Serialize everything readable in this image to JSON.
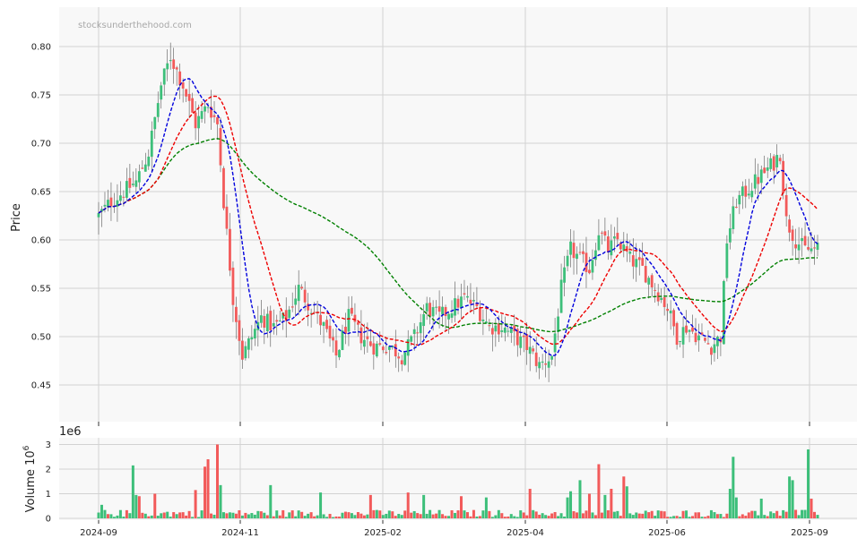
{
  "chart_data": {
    "type": "candlestick",
    "watermark": "stocksunderthehood.com",
    "ylabel": "Price",
    "volume_ylabel": "Volume  10",
    "volume_ylabel_exp": "6",
    "volume_offset_text": "1e6",
    "x_ticks": [
      "2024-09",
      "2024-11",
      "2025-02",
      "2025-04",
      "2025-06",
      "2025-09"
    ],
    "y_ticks": [
      "0.45",
      "0.50",
      "0.55",
      "0.60",
      "0.65",
      "0.70",
      "0.75",
      "0.80"
    ],
    "volume_ticks": [
      "0",
      "1",
      "2",
      "3"
    ],
    "ylim": [
      0.41,
      0.84
    ],
    "volume_ylim": [
      0,
      3.0
    ],
    "grid": true,
    "colors": {
      "up": "#3dbf7a",
      "down": "#f25a5a",
      "ma_short": "#0000dd",
      "ma_mid": "#ee0000",
      "ma_long": "#008000",
      "wick": "#555555"
    },
    "price_anchors": [
      {
        "t": 0,
        "p": 0.625
      },
      {
        "t": 4,
        "p": 0.64
      },
      {
        "t": 8,
        "p": 0.65
      },
      {
        "t": 12,
        "p": 0.66
      },
      {
        "t": 16,
        "p": 0.69
      },
      {
        "t": 20,
        "p": 0.76
      },
      {
        "t": 23,
        "p": 0.79
      },
      {
        "t": 27,
        "p": 0.76
      },
      {
        "t": 31,
        "p": 0.72
      },
      {
        "t": 35,
        "p": 0.74
      },
      {
        "t": 38,
        "p": 0.72
      },
      {
        "t": 40,
        "p": 0.64
      },
      {
        "t": 43,
        "p": 0.54
      },
      {
        "t": 46,
        "p": 0.48
      },
      {
        "t": 49,
        "p": 0.5
      },
      {
        "t": 52,
        "p": 0.52
      },
      {
        "t": 56,
        "p": 0.51
      },
      {
        "t": 60,
        "p": 0.52
      },
      {
        "t": 64,
        "p": 0.55
      },
      {
        "t": 68,
        "p": 0.53
      },
      {
        "t": 72,
        "p": 0.51
      },
      {
        "t": 76,
        "p": 0.48
      },
      {
        "t": 80,
        "p": 0.52
      },
      {
        "t": 84,
        "p": 0.5
      },
      {
        "t": 88,
        "p": 0.49
      },
      {
        "t": 93,
        "p": 0.49
      },
      {
        "t": 97,
        "p": 0.48
      },
      {
        "t": 101,
        "p": 0.5
      },
      {
        "t": 105,
        "p": 0.53
      },
      {
        "t": 109,
        "p": 0.52
      },
      {
        "t": 113,
        "p": 0.53
      },
      {
        "t": 117,
        "p": 0.54
      },
      {
        "t": 121,
        "p": 0.53
      },
      {
        "t": 125,
        "p": 0.51
      },
      {
        "t": 129,
        "p": 0.51
      },
      {
        "t": 133,
        "p": 0.5
      },
      {
        "t": 137,
        "p": 0.49
      },
      {
        "t": 141,
        "p": 0.47
      },
      {
        "t": 145,
        "p": 0.48
      },
      {
        "t": 148,
        "p": 0.55
      },
      {
        "t": 151,
        "p": 0.59
      },
      {
        "t": 154,
        "p": 0.58
      },
      {
        "t": 157,
        "p": 0.57
      },
      {
        "t": 160,
        "p": 0.61
      },
      {
        "t": 163,
        "p": 0.59
      },
      {
        "t": 166,
        "p": 0.6
      },
      {
        "t": 170,
        "p": 0.58
      },
      {
        "t": 174,
        "p": 0.57
      },
      {
        "t": 178,
        "p": 0.55
      },
      {
        "t": 182,
        "p": 0.53
      },
      {
        "t": 185,
        "p": 0.5
      },
      {
        "t": 188,
        "p": 0.51
      },
      {
        "t": 192,
        "p": 0.5
      },
      {
        "t": 196,
        "p": 0.49
      },
      {
        "t": 199,
        "p": 0.5
      },
      {
        "t": 201,
        "p": 0.6
      },
      {
        "t": 204,
        "p": 0.64
      },
      {
        "t": 207,
        "p": 0.65
      },
      {
        "t": 210,
        "p": 0.66
      },
      {
        "t": 213,
        "p": 0.67
      },
      {
        "t": 216,
        "p": 0.68
      },
      {
        "t": 218,
        "p": 0.69
      },
      {
        "t": 220,
        "p": 0.62
      },
      {
        "t": 223,
        "p": 0.6
      },
      {
        "t": 226,
        "p": 0.59
      },
      {
        "t": 229,
        "p": 0.59
      }
    ],
    "volume_spikes": [
      {
        "t": 1,
        "v": 0.55,
        "up": true
      },
      {
        "t": 11,
        "v": 2.15,
        "up": true
      },
      {
        "t": 12,
        "v": 0.95,
        "up": true
      },
      {
        "t": 13,
        "v": 0.9,
        "up": false
      },
      {
        "t": 18,
        "v": 1.0,
        "up": false
      },
      {
        "t": 31,
        "v": 1.15,
        "up": false
      },
      {
        "t": 34,
        "v": 2.1,
        "up": false
      },
      {
        "t": 35,
        "v": 2.4,
        "up": false
      },
      {
        "t": 38,
        "v": 3.0,
        "up": false
      },
      {
        "t": 39,
        "v": 1.35,
        "up": true
      },
      {
        "t": 55,
        "v": 1.35,
        "up": true
      },
      {
        "t": 71,
        "v": 1.05,
        "up": true
      },
      {
        "t": 87,
        "v": 0.95,
        "up": false
      },
      {
        "t": 99,
        "v": 1.05,
        "up": false
      },
      {
        "t": 104,
        "v": 0.95,
        "up": true
      },
      {
        "t": 116,
        "v": 0.9,
        "up": false
      },
      {
        "t": 124,
        "v": 0.85,
        "up": true
      },
      {
        "t": 138,
        "v": 1.2,
        "up": false
      },
      {
        "t": 150,
        "v": 0.85,
        "up": true
      },
      {
        "t": 151,
        "v": 1.1,
        "up": true
      },
      {
        "t": 154,
        "v": 1.55,
        "up": true
      },
      {
        "t": 157,
        "v": 1.0,
        "up": false
      },
      {
        "t": 160,
        "v": 2.2,
        "up": false
      },
      {
        "t": 162,
        "v": 0.95,
        "up": true
      },
      {
        "t": 164,
        "v": 1.2,
        "up": false
      },
      {
        "t": 168,
        "v": 1.7,
        "up": false
      },
      {
        "t": 169,
        "v": 1.3,
        "up": true
      },
      {
        "t": 202,
        "v": 1.2,
        "up": true
      },
      {
        "t": 203,
        "v": 2.5,
        "up": true
      },
      {
        "t": 204,
        "v": 0.85,
        "up": true
      },
      {
        "t": 212,
        "v": 0.8,
        "up": true
      },
      {
        "t": 221,
        "v": 1.7,
        "up": true
      },
      {
        "t": 222,
        "v": 1.55,
        "up": true
      },
      {
        "t": 227,
        "v": 2.8,
        "up": true
      },
      {
        "t": 228,
        "v": 0.8,
        "up": false
      }
    ],
    "n_periods": 231
  }
}
